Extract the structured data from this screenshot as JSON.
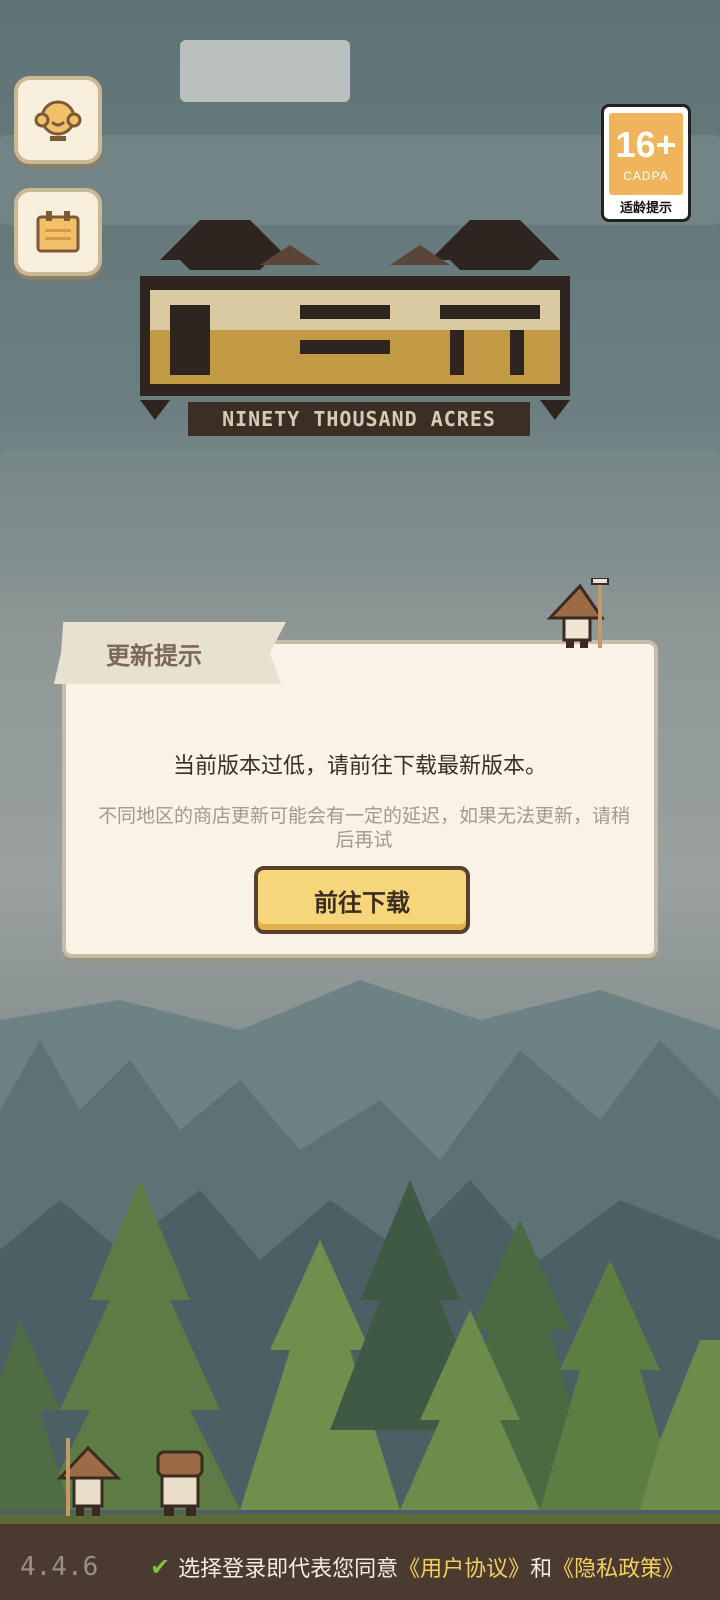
{
  "side_buttons": [
    {
      "name": "customer-service",
      "icon": "headset-icon"
    },
    {
      "name": "announcement",
      "icon": "notice-board-icon"
    }
  ],
  "age_rating": {
    "number": "16+",
    "label": "CADPA",
    "caption": "适龄提示"
  },
  "logo": {
    "subtitle": "NINETY THOUSAND ACRES"
  },
  "dialog": {
    "title": "更新提示",
    "message": "当前版本过低，请前往下载最新版本。",
    "note": "不同地区的商店更新可能会有一定的延迟，如果无法更新，请稍后再试",
    "button_label": "前往下载"
  },
  "footer": {
    "version": "4.4.6",
    "agreement_prefix": "选择登录即代表您同意",
    "user_agreement": "《用户协议》",
    "and": "和",
    "privacy_policy": "《隐私政策》"
  },
  "colors": {
    "accent": "#f6d67b",
    "link": "#f3cf5c",
    "check": "#7ec13a"
  }
}
